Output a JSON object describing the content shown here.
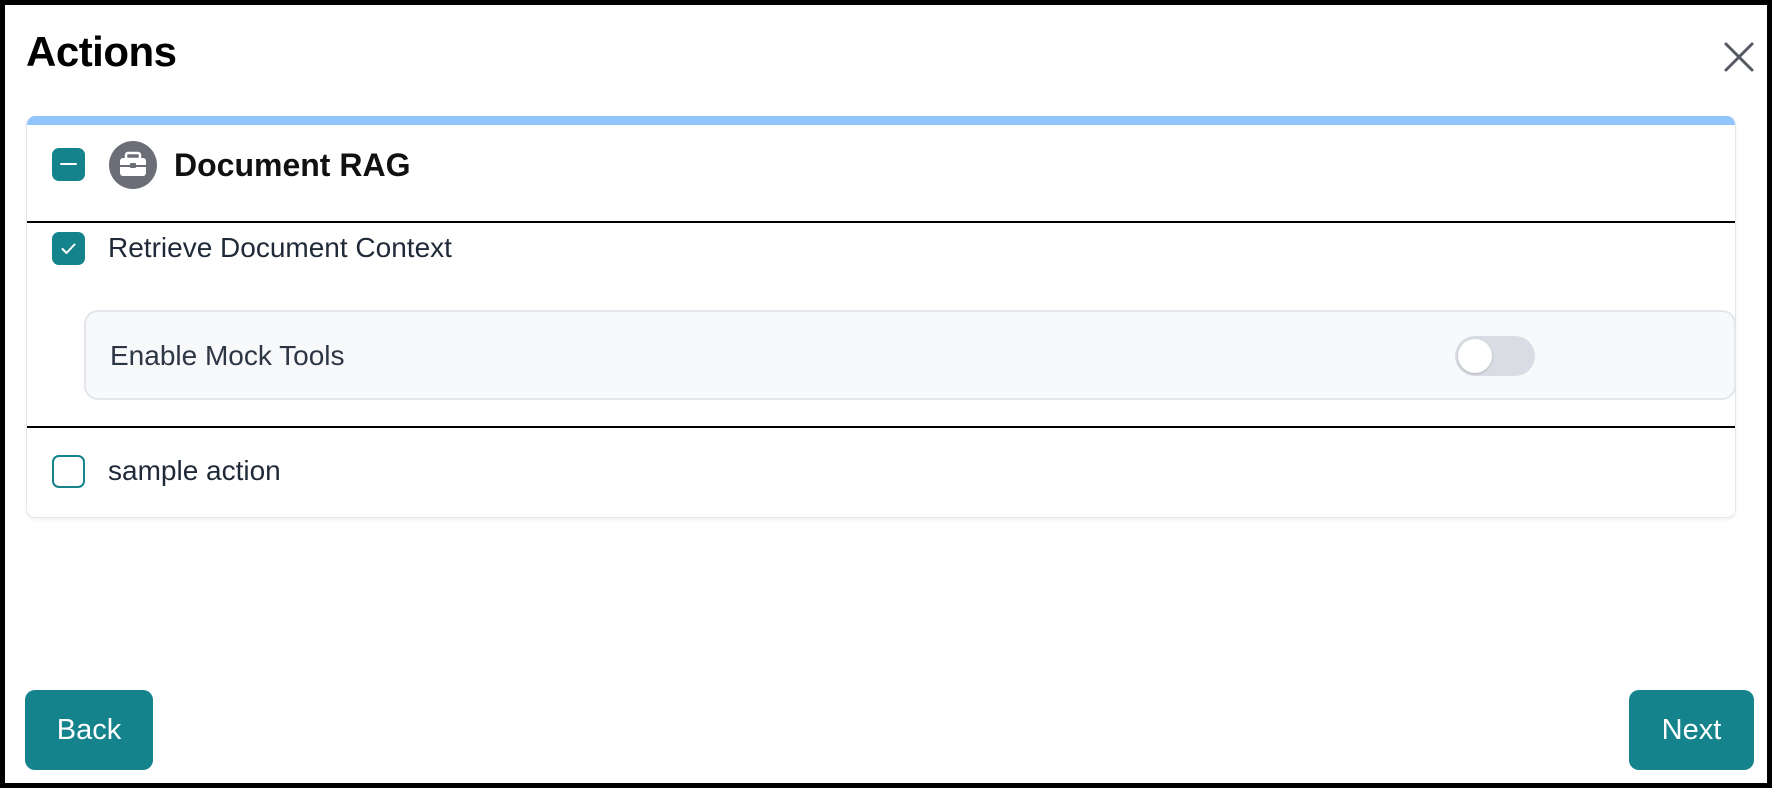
{
  "dialog": {
    "title": "Actions",
    "close_icon": "close-icon"
  },
  "group": {
    "title": "Document RAG",
    "icon": "briefcase-icon",
    "checkbox_state": "indeterminate",
    "accent_color": "#93c5fd"
  },
  "actions": [
    {
      "label": "Retrieve Document Context",
      "checked": true,
      "mock_tools": {
        "label": "Enable Mock Tools",
        "enabled": false
      }
    },
    {
      "label": "sample action",
      "checked": false
    }
  ],
  "footer": {
    "back_label": "Back",
    "next_label": "Next"
  },
  "colors": {
    "primary": "#14838c",
    "toggle_off": "#d9dde3"
  }
}
